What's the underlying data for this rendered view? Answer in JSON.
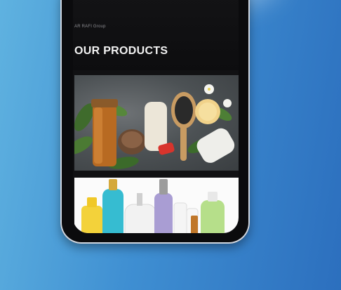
{
  "header": {
    "brand": "AR RAFI Group",
    "title": "OUR PRODUCTS"
  },
  "products": [
    {
      "name": "hair-care-products-image"
    },
    {
      "name": "cosmetic-bottles-image"
    }
  ],
  "colors": {
    "background_start": "#5fb2e0",
    "background_end": "#2c6fbe",
    "screen": "#111113",
    "title_text": "#f2f2f2"
  }
}
